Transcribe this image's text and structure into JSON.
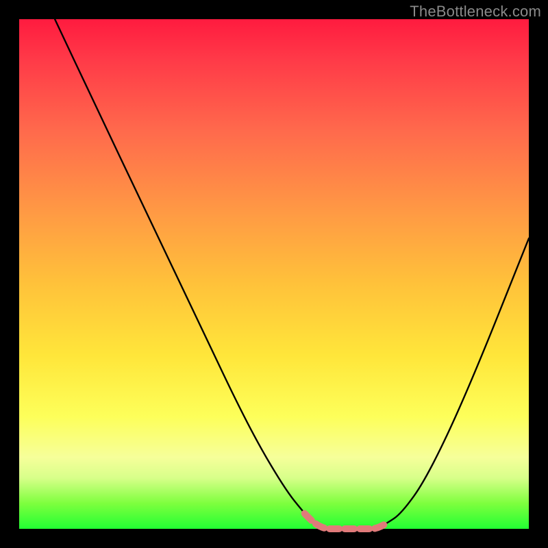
{
  "watermark": "TheBottleneck.com",
  "chart_data": {
    "type": "line",
    "title": "",
    "xlabel": "",
    "ylabel": "",
    "xlim": [
      0,
      100
    ],
    "ylim": [
      0,
      100
    ],
    "grid": false,
    "series": [
      {
        "name": "curve",
        "color": "#000000",
        "x": [
          7,
          15,
          25,
          35,
          45,
          52,
          56,
          58,
          60,
          65,
          70,
          72,
          75,
          80,
          88,
          100
        ],
        "y": [
          100,
          83,
          62,
          41,
          20,
          8,
          3,
          1,
          0,
          0,
          0,
          1,
          3,
          10,
          27,
          57
        ]
      },
      {
        "name": "flat-highlight",
        "color": "#e07a7a",
        "x": [
          56,
          58,
          60,
          62,
          64,
          66,
          68,
          70,
          72
        ],
        "y": [
          3,
          1,
          0,
          0,
          0,
          0,
          0,
          0,
          1
        ]
      }
    ],
    "annotations": []
  },
  "colors": {
    "background": "#000000",
    "gradient_top": "#ff1b3f",
    "gradient_bottom": "#22ff33",
    "curve": "#000000",
    "highlight": "#e07a7a",
    "watermark": "#8a8a8a"
  }
}
